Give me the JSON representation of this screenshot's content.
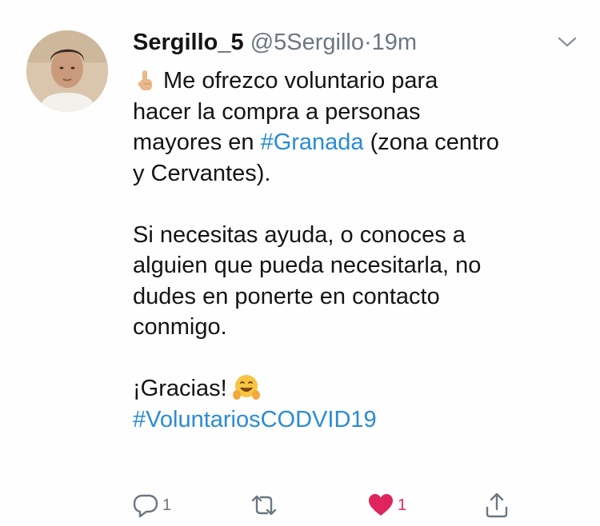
{
  "tweet": {
    "author_name": "Sergillo_5",
    "handle": "@5Sergillo",
    "separator": "·",
    "time": "19m",
    "paragraphs": {
      "p1_line1_text": "Me ofrezco voluntario para",
      "p1_line2": "hacer la compra a personas",
      "p1_line3_before": "mayores en ",
      "p1_hashtag": "#Granada",
      "p1_line3_after": " (zona centro",
      "p1_line4": "y Cervantes).",
      "p2_line1": "Si necesitas ayuda, o conoces a",
      "p2_line2": "alguien que pueda necesitarla, no",
      "p2_line3": "dudes en ponerte en contacto",
      "p2_line4": "conmigo.",
      "p3_line1": "¡Gracias!",
      "p3_hashtag": "#VoluntariosCODVID19"
    },
    "icons": {
      "avatar": "avatar",
      "emoji_1": "index-pointing-up-emoji",
      "emoji_2": "hugging-face-emoji",
      "caret": "chevron-down-icon"
    }
  },
  "actions": {
    "reply_count": "1",
    "retweet_count": "",
    "like_count": "1",
    "like_active": true
  },
  "colors": {
    "link": "#2a8bd6",
    "muted": "#6b7782",
    "like": "#e0245e"
  }
}
